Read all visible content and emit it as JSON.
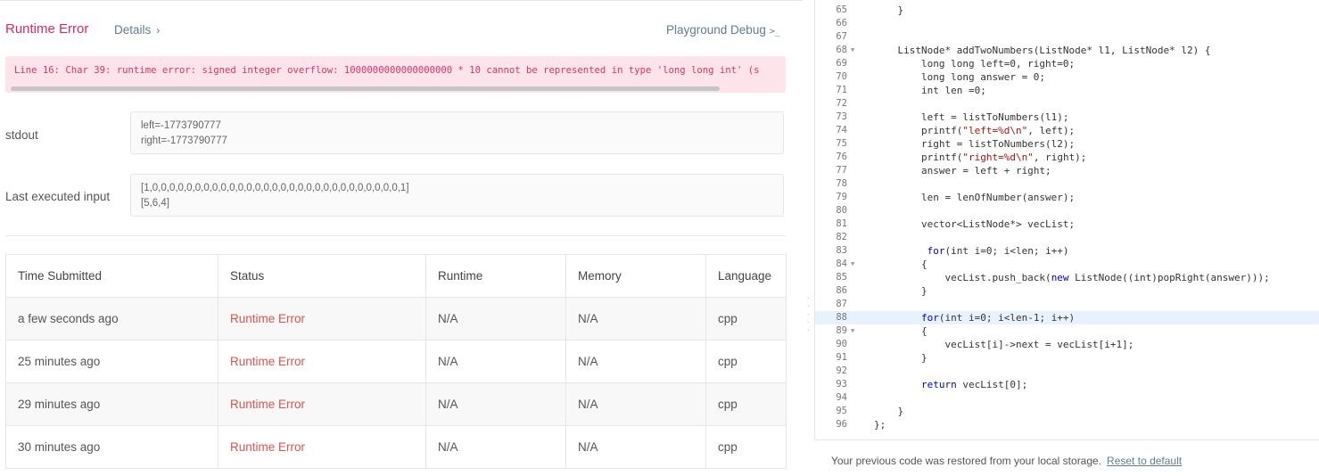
{
  "result": {
    "title": "Runtime Error",
    "details_label": "Details",
    "details_chevron": "›",
    "playground_label": "Playground Debug",
    "playground_icon": ">_",
    "error_message": "Line 16: Char 39: runtime error: signed integer overflow: 1000000000000000000 * 10 cannot be represented in type 'long long int' (s"
  },
  "stdout": {
    "label": "stdout",
    "lines": [
      "left=-1773790777",
      "right=-1773790777"
    ]
  },
  "last_input": {
    "label": "Last executed input",
    "lines": [
      "[1,0,0,0,0,0,0,0,0,0,0,0,0,0,0,0,0,0,0,0,0,0,0,0,0,0,0,0,0,0,1]",
      "[5,6,4]"
    ]
  },
  "submissions": {
    "headers": [
      "Time Submitted",
      "Status",
      "Runtime",
      "Memory",
      "Language"
    ],
    "rows": [
      {
        "time": "a few seconds ago",
        "status": "Runtime Error",
        "runtime": "N/A",
        "memory": "N/A",
        "language": "cpp"
      },
      {
        "time": "25 minutes ago",
        "status": "Runtime Error",
        "runtime": "N/A",
        "memory": "N/A",
        "language": "cpp"
      },
      {
        "time": "29 minutes ago",
        "status": "Runtime Error",
        "runtime": "N/A",
        "memory": "N/A",
        "language": "cpp"
      },
      {
        "time": "30 minutes ago",
        "status": "Runtime Error",
        "runtime": "N/A",
        "memory": "N/A",
        "language": "cpp"
      }
    ]
  },
  "editor": {
    "lines": [
      {
        "n": "65",
        "code": "    }"
      },
      {
        "n": "66",
        "code": ""
      },
      {
        "n": "67",
        "code": ""
      },
      {
        "n": "68",
        "code": "    ListNode* addTwoNumbers(ListNode* l1, ListNode* l2) {",
        "fold": true
      },
      {
        "n": "69",
        "code": "        long long left=0, right=0;"
      },
      {
        "n": "70",
        "code": "        long long answer = 0;"
      },
      {
        "n": "71",
        "code": "        int len =0;"
      },
      {
        "n": "72",
        "code": ""
      },
      {
        "n": "73",
        "code": "        left = listToNumbers(l1);"
      },
      {
        "n": "74",
        "code": "        printf(\"left=%d\\n\", left);"
      },
      {
        "n": "75",
        "code": "        right = listToNumbers(l2);"
      },
      {
        "n": "76",
        "code": "        printf(\"right=%d\\n\", right);"
      },
      {
        "n": "77",
        "code": "        answer = left + right;"
      },
      {
        "n": "78",
        "code": ""
      },
      {
        "n": "79",
        "code": "        len = lenOfNumber(answer);"
      },
      {
        "n": "80",
        "code": ""
      },
      {
        "n": "81",
        "code": "        vector<ListNode*> vecList;"
      },
      {
        "n": "82",
        "code": ""
      },
      {
        "n": "83",
        "code": "         for(int i=0; i<len; i++)"
      },
      {
        "n": "84",
        "code": "        {",
        "fold": true
      },
      {
        "n": "85",
        "code": "            vecList.push_back(new ListNode((int)popRight(answer)));"
      },
      {
        "n": "86",
        "code": "        }"
      },
      {
        "n": "87",
        "code": ""
      },
      {
        "n": "88",
        "code": "        for(int i=0; i<len-1; i++)",
        "active": true
      },
      {
        "n": "89",
        "code": "        {",
        "fold": true
      },
      {
        "n": "90",
        "code": "            vecList[i]->next = vecList[i+1];"
      },
      {
        "n": "91",
        "code": "        }"
      },
      {
        "n": "92",
        "code": ""
      },
      {
        "n": "93",
        "code": "        return vecList[0];"
      },
      {
        "n": "94",
        "code": ""
      },
      {
        "n": "95",
        "code": "    }"
      },
      {
        "n": "96",
        "code": "};"
      }
    ]
  },
  "footer": {
    "message": "Your previous code was restored from your local storage.",
    "reset_label": "Reset to default"
  },
  "colors": {
    "error": "#e0245e",
    "error_bg": "#fde4ea",
    "link": "#607d8b",
    "active_line": "#e8f2ff"
  }
}
